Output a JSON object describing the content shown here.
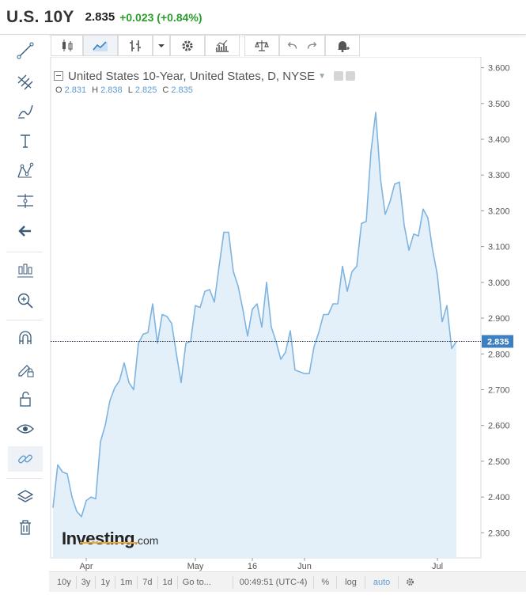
{
  "header": {
    "symbol": "U.S. 10Y",
    "last": "2.835",
    "change": "+0.023 (+0.84%)"
  },
  "legend": {
    "title": "United States 10-Year, United States, D, NYSE",
    "o_label": "O",
    "o_value": "2.831",
    "h_label": "H",
    "h_value": "2.838",
    "l_label": "L",
    "l_value": "2.825",
    "c_label": "C",
    "c_value": "2.835"
  },
  "left_toolbar": [
    "trend-line-icon",
    "fib-tools-icon",
    "brush-icon",
    "text-icon",
    "pattern-icon",
    "measure-icon",
    "back-arrow-icon",
    "candles-icon",
    "zoom-icon",
    "magnet-icon",
    "lock-drawing-icon",
    "unlock-icon",
    "eye-icon",
    "link-icon",
    "layers-icon",
    "trash-icon"
  ],
  "top_toolbar": [
    "candles-icon",
    "line-chart-icon",
    "bar-type-icon",
    "dropdown-icon",
    "settings-icon",
    "indicators-icon",
    "compare-icon",
    "undo-icon",
    "redo-icon",
    "alert-icon"
  ],
  "bottom_bar": {
    "ranges": [
      "10y",
      "3y",
      "1y",
      "1m",
      "7d",
      "1d"
    ],
    "goto": "Go to...",
    "time": "00:49:51 (UTC-4)",
    "pct": "%",
    "log": "log",
    "auto": "auto"
  },
  "brand": {
    "name": "Investing",
    "suffix": ".com"
  },
  "colors": {
    "line": "#7fb4e0",
    "fill": "#e3f0fa",
    "up": "#2a9e2a",
    "accent": "#5b9bd5"
  },
  "chart_data": {
    "type": "area",
    "title": "United States 10-Year, United States, D, NYSE",
    "y_ticks": [
      2.3,
      2.4,
      2.5,
      2.6,
      2.7,
      2.8,
      2.9,
      3.0,
      3.1,
      3.2,
      3.3,
      3.4,
      3.5,
      3.6
    ],
    "y_tick_labels": [
      "2.300",
      "2.400",
      "2.500",
      "2.600",
      "2.700",
      "2.800",
      "2.900",
      "3.000",
      "3.100",
      "3.200",
      "3.300",
      "3.400",
      "3.500",
      "3.600"
    ],
    "ylim": [
      2.23,
      3.63
    ],
    "x_tick_labels": [
      {
        "label": "Apr",
        "index": 7
      },
      {
        "label": "May",
        "index": 30
      },
      {
        "label": "16",
        "index": 42
      },
      {
        "label": "Jun",
        "index": 53
      },
      {
        "label": "Jul",
        "index": 81
      }
    ],
    "last_price": 2.835,
    "last_price_label": "2.835",
    "values": [
      2.37,
      2.49,
      2.47,
      2.465,
      2.4,
      2.36,
      2.345,
      2.39,
      2.4,
      2.395,
      2.555,
      2.6,
      2.67,
      2.705,
      2.725,
      2.775,
      2.72,
      2.7,
      2.83,
      2.855,
      2.86,
      2.94,
      2.83,
      2.91,
      2.905,
      2.885,
      2.8,
      2.72,
      2.83,
      2.835,
      2.935,
      2.93,
      2.975,
      2.98,
      2.945,
      3.045,
      3.14,
      3.14,
      3.03,
      2.99,
      2.925,
      2.85,
      2.925,
      2.94,
      2.875,
      3.0,
      2.875,
      2.835,
      2.785,
      2.805,
      2.865,
      2.755,
      2.75,
      2.745,
      2.745,
      2.82,
      2.86,
      2.91,
      2.91,
      2.94,
      2.94,
      3.045,
      2.975,
      3.03,
      3.045,
      3.165,
      3.17,
      3.365,
      3.475,
      3.29,
      3.19,
      3.225,
      3.275,
      3.28,
      3.16,
      3.09,
      3.135,
      3.13,
      3.205,
      3.18,
      3.09,
      3.02,
      2.89,
      2.935,
      2.815,
      2.835
    ]
  }
}
